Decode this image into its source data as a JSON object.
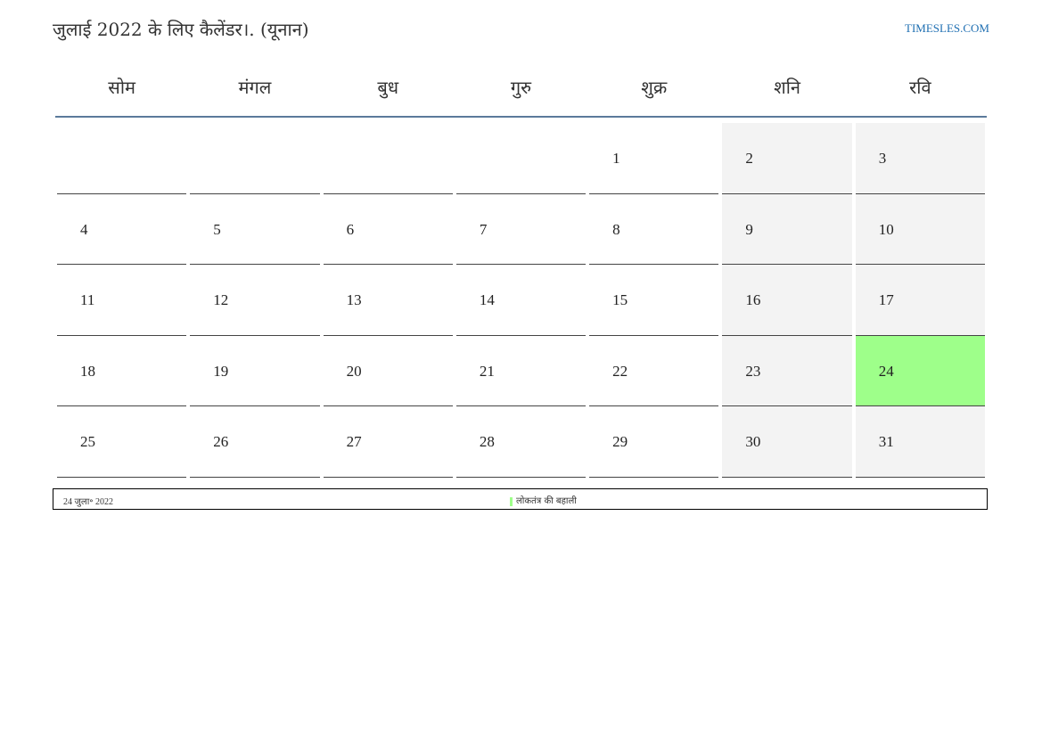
{
  "header": {
    "title": "जुलाई 2022 के लिए कैलेंडर।. (यूनान)",
    "site": "TIMESLES.COM"
  },
  "calendar": {
    "weekdays": [
      "सोम",
      "मंगल",
      "बुध",
      "गुरु",
      "शुक्र",
      "शनि",
      "रवि"
    ],
    "weeks": [
      [
        "",
        "",
        "",
        "",
        "1",
        "2",
        "3"
      ],
      [
        "4",
        "5",
        "6",
        "7",
        "8",
        "9",
        "10"
      ],
      [
        "11",
        "12",
        "13",
        "14",
        "15",
        "16",
        "17"
      ],
      [
        "18",
        "19",
        "20",
        "21",
        "22",
        "23",
        "24"
      ],
      [
        "25",
        "26",
        "27",
        "28",
        "29",
        "30",
        "31"
      ]
    ],
    "highlighted_day": "24"
  },
  "footer": {
    "date": "24 जुला॰ 2022",
    "legend_label": "लोकतंत्र की बहाली"
  },
  "colors": {
    "weekend_bg": "#f3f3f3",
    "highlight": "#9eff8a",
    "header_rule": "#5b7a9b",
    "site_link": "#1f6fb2"
  }
}
